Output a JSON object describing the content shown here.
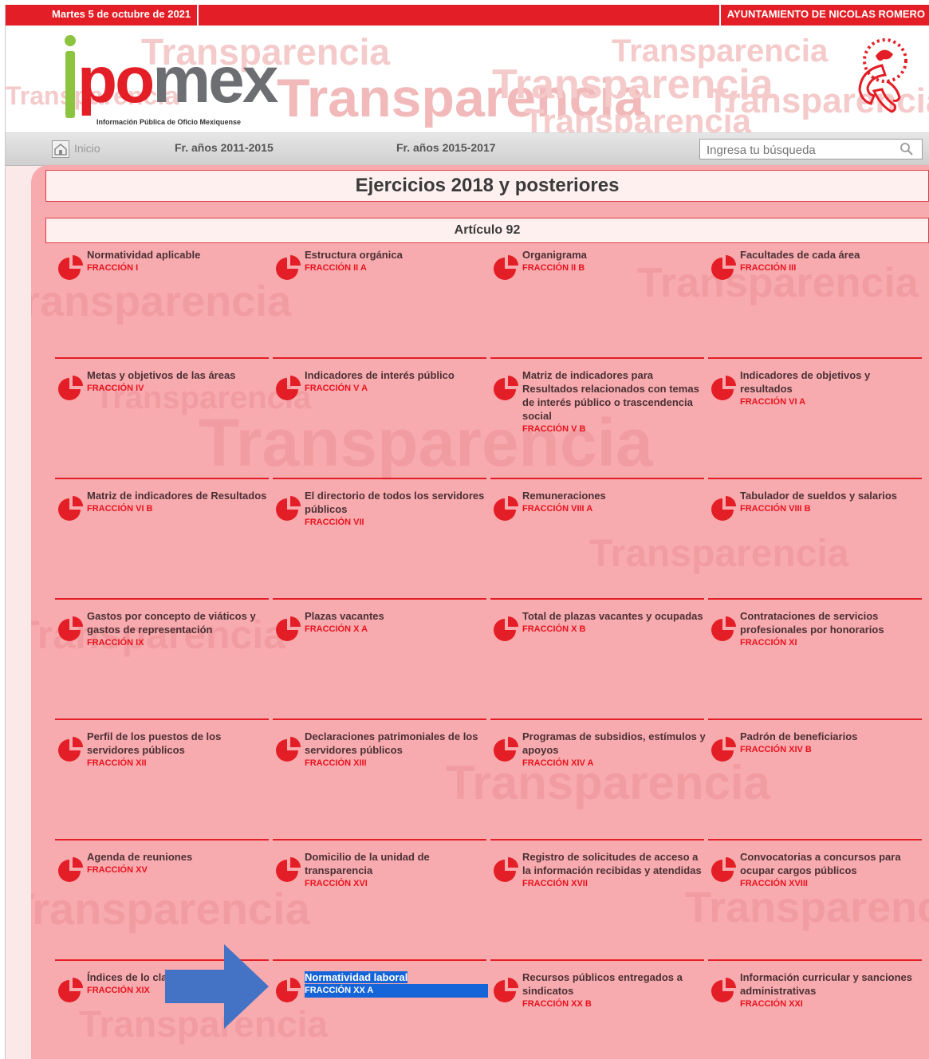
{
  "topbar": {
    "date": "Martes 5 de octubre de 2021",
    "organization": "AYUNTAMIENTO DE NICOLAS ROMERO"
  },
  "header": {
    "logo_text_po": "po",
    "logo_text_mex": "mex",
    "logo_tagline": "Información Pública de Oficio Mexiquense",
    "watermark": "Transparencia",
    "emblem_icon": "municipal-emblem-icon"
  },
  "nav": {
    "home_label": "Inicio",
    "link1": "Fr. años 2011-2015",
    "link2": "Fr. años 2015-2017",
    "search_placeholder": "Ingresa tu búsqueda"
  },
  "content": {
    "section_title": "Ejercicios 2018 y posteriores",
    "article_title": "Artículo 92",
    "items": [
      {
        "title": "Normatividad aplicable",
        "fraction": "FRACCIÓN I"
      },
      {
        "title": "Estructura orgánica",
        "fraction": "FRACCIÓN II A"
      },
      {
        "title": "Organigrama",
        "fraction": "FRACCIÓN II B"
      },
      {
        "title": "Facultades de cada área",
        "fraction": "FRACCIÓN III"
      },
      {
        "title": "Metas y objetivos de las áreas",
        "fraction": "FRACCIÓN IV"
      },
      {
        "title": "Indicadores de interés público",
        "fraction": "FRACCIÓN V A"
      },
      {
        "title": "Matriz de indicadores para Resultados relacionados con temas de interés público o trascendencia social",
        "fraction": "FRACCIÓN V B"
      },
      {
        "title": "Indicadores de objetivos y resultados",
        "fraction": "FRACCIÓN VI A"
      },
      {
        "title": "Matriz de indicadores de Resultados",
        "fraction": "FRACCIÓN VI B"
      },
      {
        "title": "El directorio de todos los servidores públicos",
        "fraction": "FRACCIÓN VII"
      },
      {
        "title": "Remuneraciones",
        "fraction": "FRACCIÓN VIII A"
      },
      {
        "title": "Tabulador de sueldos y salarios",
        "fraction": "FRACCIÓN VIII B"
      },
      {
        "title": "Gastos por concepto de viáticos y gastos de representación",
        "fraction": "FRACCIÓN IX"
      },
      {
        "title": "Plazas vacantes",
        "fraction": "FRACCIÓN X A"
      },
      {
        "title": "Total de plazas vacantes y ocupadas",
        "fraction": "FRACCIÓN X B"
      },
      {
        "title": "Contrataciones de servicios profesionales por honorarios",
        "fraction": "FRACCIÓN XI"
      },
      {
        "title": "Perfil de los puestos de los servidores públicos",
        "fraction": "FRACCIÓN XII"
      },
      {
        "title": "Declaraciones patrimoniales de los servidores públicos",
        "fraction": "FRACCIÓN XIII"
      },
      {
        "title": "Programas de subsidios, estímulos y apoyos",
        "fraction": "FRACCIÓN XIV A"
      },
      {
        "title": "Padrón de beneficiarios",
        "fraction": "FRACCIÓN XIV B"
      },
      {
        "title": "Agenda de reuniones",
        "fraction": "FRACCIÓN XV"
      },
      {
        "title": "Domicilio de la unidad de transparencia",
        "fraction": "FRACCIÓN XVI"
      },
      {
        "title": "Registro de solicitudes de acceso a la información recibidas y atendidas",
        "fraction": "FRACCIÓN XVII"
      },
      {
        "title": "Convocatorias a concursos para ocupar cargos públicos",
        "fraction": "FRACCIÓN XVIII"
      },
      {
        "title": "Índices de lo clasificados c",
        "fraction": "FRACCIÓN XIX"
      },
      {
        "title": "Normatividad laboral",
        "fraction": "FRACCIÓN XX A"
      },
      {
        "title": "Recursos públicos entregados a sindicatos",
        "fraction": "FRACCIÓN XX B"
      },
      {
        "title": "Información curricular y sanciones administrativas",
        "fraction": "FRACCIÓN XXI"
      }
    ]
  },
  "colors": {
    "brand_red": "#e41e26",
    "content_bg": "#f8abae",
    "logo_green": "#8dc43f",
    "logo_gray": "#6d6e71",
    "selection_blue": "#1565d8",
    "arrow_blue": "#4472c4"
  },
  "annotation": {
    "arrow_icon": "blue-arrow-icon",
    "highlighted_item": "Normatividad laboral"
  }
}
